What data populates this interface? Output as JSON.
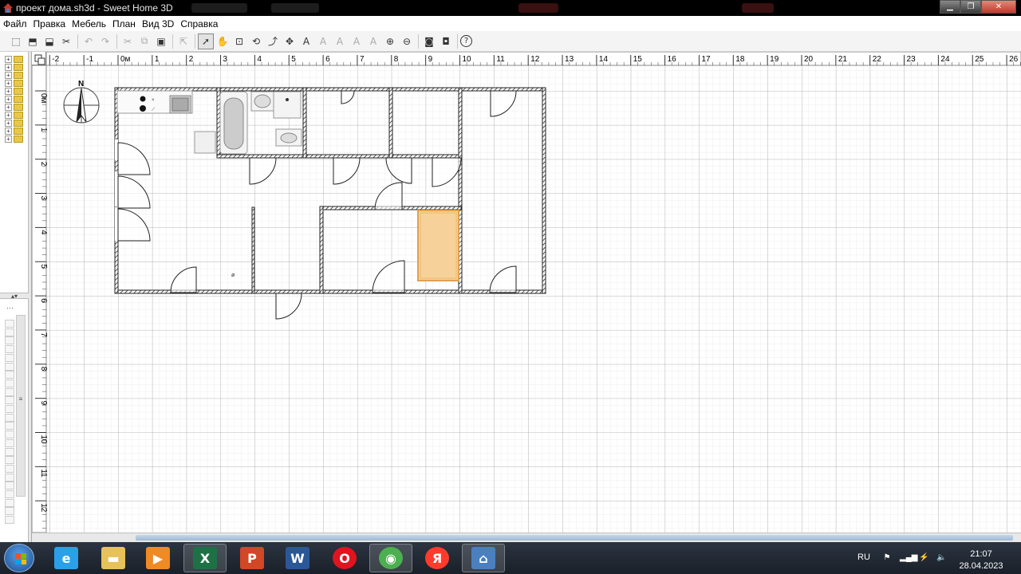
{
  "window": {
    "title": "проект дома.sh3d - Sweet Home 3D"
  },
  "menu": [
    "Файл",
    "Правка",
    "Мебель",
    "План",
    "Вид 3D",
    "Справка"
  ],
  "toolbar": [
    {
      "icon": "new-home-icon",
      "dis": false
    },
    {
      "icon": "open-icon",
      "dis": false
    },
    {
      "icon": "save-icon",
      "dis": false
    },
    {
      "icon": "cut-icon",
      "dis": false
    },
    {
      "sep": true
    },
    {
      "icon": "undo-icon",
      "dis": true
    },
    {
      "icon": "redo-icon",
      "dis": true
    },
    {
      "sep": true
    },
    {
      "icon": "cut-icon",
      "dis": true
    },
    {
      "icon": "copy-icon",
      "dis": true
    },
    {
      "icon": "paste-icon",
      "dis": false
    },
    {
      "sep": true
    },
    {
      "icon": "add-furniture-icon",
      "dis": true
    },
    {
      "sep": true
    },
    {
      "icon": "select-mode-icon",
      "dis": false,
      "active": true
    },
    {
      "icon": "pan-mode-icon",
      "dis": false
    },
    {
      "icon": "create-walls-icon",
      "dis": false
    },
    {
      "icon": "create-rooms-icon",
      "dis": false
    },
    {
      "icon": "create-polylines-icon",
      "dis": false
    },
    {
      "icon": "create-dimensions-icon",
      "dis": false
    },
    {
      "icon": "create-labels-icon",
      "dis": false
    },
    {
      "icon": "increase-text-icon",
      "dis": true
    },
    {
      "icon": "decrease-text-icon",
      "dis": true
    },
    {
      "icon": "bold-text-icon",
      "dis": true
    },
    {
      "icon": "italic-text-icon",
      "dis": true
    },
    {
      "icon": "zoom-in-icon",
      "dis": false
    },
    {
      "icon": "zoom-out-icon",
      "dis": false
    },
    {
      "sep": true
    },
    {
      "icon": "create-photo-icon",
      "dis": false
    },
    {
      "icon": "create-video-icon",
      "dis": false
    },
    {
      "sep": true
    },
    {
      "icon": "help-icon",
      "dis": false
    }
  ],
  "ruler": {
    "x_labels": [
      "-2",
      "-1",
      "0м",
      "1",
      "2",
      "3",
      "4",
      "5",
      "6",
      "7",
      "8",
      "9",
      "10",
      "11",
      "12",
      "13",
      "14",
      "15",
      "16",
      "17",
      "18",
      "19",
      "20",
      "21",
      "22",
      "23",
      "24",
      "25",
      "26"
    ],
    "y_labels": [
      "0м",
      "1",
      "2",
      "3",
      "4",
      "5",
      "6",
      "7",
      "8",
      "9",
      "10",
      "11",
      "12"
    ]
  },
  "compass": {
    "label": "N"
  },
  "taskbar": {
    "apps": [
      {
        "name": "ie-icon",
        "glyph": "e",
        "color": "#2aa0e8"
      },
      {
        "name": "explorer-icon",
        "glyph": "▬",
        "color": "#e7c25a"
      },
      {
        "name": "media-player-icon",
        "glyph": "▶",
        "color": "#f08a24"
      },
      {
        "name": "excel-icon",
        "glyph": "X",
        "color": "#1e7145"
      },
      {
        "name": "powerpoint-icon",
        "glyph": "P",
        "color": "#d24726"
      },
      {
        "name": "word-icon",
        "glyph": "W",
        "color": "#2b5797"
      },
      {
        "name": "opera-icon",
        "glyph": "O",
        "color": "#e0141e"
      },
      {
        "name": "chrome-icon",
        "glyph": "◉",
        "color": "#4caf50"
      },
      {
        "name": "yandex-icon",
        "glyph": "Я",
        "color": "#ff3b2b"
      },
      {
        "name": "sweet-home-3d-icon",
        "glyph": "⌂",
        "color": "#4a7fc0"
      }
    ],
    "lang": "RU",
    "time": "21:07",
    "date": "28.04.2023"
  }
}
